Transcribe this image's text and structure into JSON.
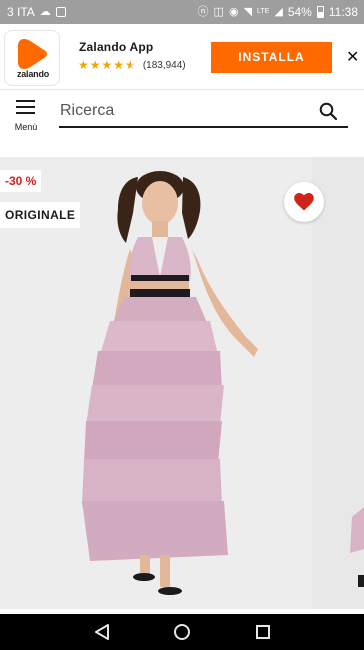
{
  "status_bar": {
    "carrier": "3 ITA",
    "battery": "54%",
    "time": "11:38",
    "signal_label": "LTE",
    "icons": [
      "cloud-icon",
      "message-icon",
      "nfc-icon",
      "mute-icon",
      "eye-icon",
      "wifi-icon",
      "signal-icon",
      "battery-icon"
    ]
  },
  "app_banner": {
    "app_name": "Zalando App",
    "logo_text": "zalando",
    "rating_stars": 4.5,
    "rating_count": "(183,944)",
    "install_label": "INSTALLA",
    "close_glyph": "✕",
    "accent_color": "#ff6900"
  },
  "header": {
    "menu_label": "Menù",
    "search_placeholder": "Ricerca"
  },
  "product": {
    "discount_badge": "-30 %",
    "originale_badge": "ORIGINALE",
    "discount_color": "#d0231c",
    "wishlist_color": "#d0231c",
    "dress_color": "#d9b6c8"
  },
  "nav_bar": {
    "icons": [
      "back-icon",
      "home-icon",
      "recents-icon"
    ]
  }
}
